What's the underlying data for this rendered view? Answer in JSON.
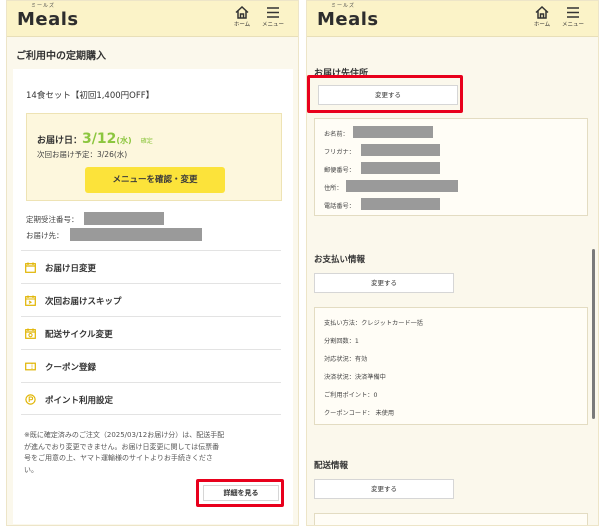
{
  "brand": {
    "ruby": "ミールズ",
    "name": "Meals"
  },
  "header": {
    "home_label": "ホーム",
    "menu_label": "メニュー"
  },
  "left": {
    "section_title": "ご利用中の定期購入",
    "product_name": "14食セット【初回1,400円OFF】",
    "delivery_label": "お届け日：",
    "delivery_date": "3/12",
    "delivery_weekday": "(水)",
    "delivery_status": "確定",
    "next_delivery": "次回お届け予定：3/26(水)",
    "menu_button": "メニューを確認・変更",
    "order_number_label": "定期受注番号：",
    "destination_label": "お届け先：",
    "menu_items": [
      {
        "label": "お届け日変更",
        "icon": "calendar-icon"
      },
      {
        "label": "次回お届けスキップ",
        "icon": "calendar-skip-icon"
      },
      {
        "label": "配送サイクル変更",
        "icon": "calendar-cycle-icon"
      },
      {
        "label": "クーポン登録",
        "icon": "coupon-icon"
      },
      {
        "label": "ポイント利用設定",
        "icon": "point-icon"
      }
    ],
    "notice_lines": [
      "※既に確定済みのご注文（2025/03/12お届け分）は、配送手配",
      "が進んでおり変更できません。お届け日変更に関しては伝票番",
      "号をご用意の上、ヤマト運輸様のサイトよりお手続きくださ",
      "い。"
    ],
    "details_button": "詳細を見る"
  },
  "right": {
    "address_title": "お届け先住所",
    "address_change_button": "変更する",
    "address_fields": [
      "お名前：",
      "フリガナ：",
      "郵便番号：",
      "住所：",
      "電話番号："
    ],
    "payment_title": "お支払い情報",
    "payment_change_button": "変更する",
    "payment_fields": [
      "支払い方法：クレジットカード一括",
      "分割回数：1",
      "対応状況：有効",
      "決済状況：決済準備中",
      "ご利用ポイント：0",
      "クーポンコード： 未使用"
    ],
    "shipping_title": "配送情報",
    "shipping_change_button": "変更する"
  },
  "colors": {
    "accent_yellow": "#fce33a",
    "highlight_red": "#e8001c",
    "date_green": "#8cc63f",
    "header_bg": "#fbf3c8"
  }
}
